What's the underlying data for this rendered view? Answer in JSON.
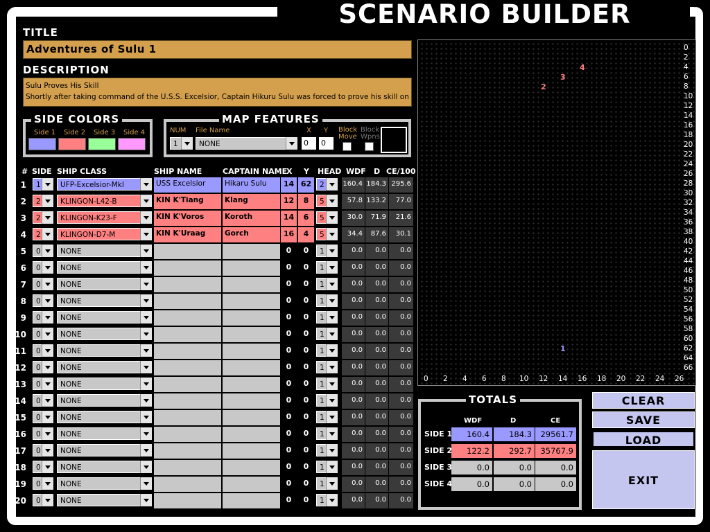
{
  "app_title": "SCENARIO BUILDER",
  "title_label": "TITLE",
  "title_value": "Adventures of Sulu 1",
  "description_label": "DESCRIPTION",
  "description_lines": [
    "Sulu Proves His Skill",
    "Shortly after taking command of the U.S.S. Excelsior, Captain Hikuru Sulu was forced to prove his skill on the"
  ],
  "side_colors": {
    "label": "SIDE COLORS",
    "sides": [
      {
        "label": "Side 1",
        "color": "#9999ff"
      },
      {
        "label": "Side 2",
        "color": "#ff8080"
      },
      {
        "label": "Side 3",
        "color": "#99ff99"
      },
      {
        "label": "Side 4",
        "color": "#ff99ff"
      }
    ]
  },
  "map_features": {
    "label": "MAP FEATURES",
    "num_label": "NUM",
    "num_value": "1",
    "file_name_label": "File Name",
    "file_name_value": "NONE",
    "x_label": "X",
    "x_value": "0",
    "y_label": "Y",
    "y_value": "0",
    "block_move_label": "Block Move",
    "block_wpns_label": "Block Wpns"
  },
  "table_headers": {
    "num": "#",
    "side": "SIDE",
    "ship_class": "SHIP CLASS",
    "ship_name": "SHIP NAME",
    "captain": "CAPTAIN NAME",
    "x": "X",
    "y": "Y",
    "head": "HEAD",
    "wdf": "WDF",
    "d": "D",
    "ce": "CE/100"
  },
  "rows": [
    {
      "n": "1",
      "side": "1",
      "cls": "UFP-Excelsior-MkI",
      "name": "USS Excelsior",
      "capt": "Hikaru Sulu",
      "x": "14",
      "y": "62",
      "head": "2",
      "wdf": "160.4",
      "d": "184.3",
      "ce": "295.6"
    },
    {
      "n": "2",
      "side": "2",
      "cls": "KLINGON-L42-B",
      "name": "KIN K'Tiang",
      "capt": "Klang",
      "x": "12",
      "y": "8",
      "head": "5",
      "wdf": "57.8",
      "d": "133.2",
      "ce": "77.0"
    },
    {
      "n": "3",
      "side": "2",
      "cls": "KLINGON-K23-F",
      "name": "KIN K'Voros",
      "capt": "Koroth",
      "x": "14",
      "y": "6",
      "head": "5",
      "wdf": "30.0",
      "d": "71.9",
      "ce": "21.6"
    },
    {
      "n": "4",
      "side": "2",
      "cls": "KLINGON-D7-M",
      "name": "KIN K'Uraag",
      "capt": "Gorch",
      "x": "16",
      "y": "4",
      "head": "5",
      "wdf": "34.4",
      "d": "87.6",
      "ce": "30.1"
    },
    {
      "n": "5",
      "side": "0",
      "cls": "NONE",
      "name": "",
      "capt": "",
      "x": "0",
      "y": "0",
      "head": "1",
      "wdf": "0.0",
      "d": "0.0",
      "ce": "0.0"
    },
    {
      "n": "6",
      "side": "0",
      "cls": "NONE",
      "name": "",
      "capt": "",
      "x": "0",
      "y": "0",
      "head": "1",
      "wdf": "0.0",
      "d": "0.0",
      "ce": "0.0"
    },
    {
      "n": "7",
      "side": "0",
      "cls": "NONE",
      "name": "",
      "capt": "",
      "x": "0",
      "y": "0",
      "head": "1",
      "wdf": "0.0",
      "d": "0.0",
      "ce": "0.0"
    },
    {
      "n": "8",
      "side": "0",
      "cls": "NONE",
      "name": "",
      "capt": "",
      "x": "0",
      "y": "0",
      "head": "1",
      "wdf": "0.0",
      "d": "0.0",
      "ce": "0.0"
    },
    {
      "n": "9",
      "side": "0",
      "cls": "NONE",
      "name": "",
      "capt": "",
      "x": "0",
      "y": "0",
      "head": "1",
      "wdf": "0.0",
      "d": "0.0",
      "ce": "0.0"
    },
    {
      "n": "10",
      "side": "0",
      "cls": "NONE",
      "name": "",
      "capt": "",
      "x": "0",
      "y": "0",
      "head": "1",
      "wdf": "0.0",
      "d": "0.0",
      "ce": "0.0"
    },
    {
      "n": "11",
      "side": "0",
      "cls": "NONE",
      "name": "",
      "capt": "",
      "x": "0",
      "y": "0",
      "head": "1",
      "wdf": "0.0",
      "d": "0.0",
      "ce": "0.0"
    },
    {
      "n": "12",
      "side": "0",
      "cls": "NONE",
      "name": "",
      "capt": "",
      "x": "0",
      "y": "0",
      "head": "1",
      "wdf": "0.0",
      "d": "0.0",
      "ce": "0.0"
    },
    {
      "n": "13",
      "side": "0",
      "cls": "NONE",
      "name": "",
      "capt": "",
      "x": "0",
      "y": "0",
      "head": "1",
      "wdf": "0.0",
      "d": "0.0",
      "ce": "0.0"
    },
    {
      "n": "14",
      "side": "0",
      "cls": "NONE",
      "name": "",
      "capt": "",
      "x": "0",
      "y": "0",
      "head": "1",
      "wdf": "0.0",
      "d": "0.0",
      "ce": "0.0"
    },
    {
      "n": "15",
      "side": "0",
      "cls": "NONE",
      "name": "",
      "capt": "",
      "x": "0",
      "y": "0",
      "head": "1",
      "wdf": "0.0",
      "d": "0.0",
      "ce": "0.0"
    },
    {
      "n": "16",
      "side": "0",
      "cls": "NONE",
      "name": "",
      "capt": "",
      "x": "0",
      "y": "0",
      "head": "1",
      "wdf": "0.0",
      "d": "0.0",
      "ce": "0.0"
    },
    {
      "n": "17",
      "side": "0",
      "cls": "NONE",
      "name": "",
      "capt": "",
      "x": "0",
      "y": "0",
      "head": "1",
      "wdf": "0.0",
      "d": "0.0",
      "ce": "0.0"
    },
    {
      "n": "18",
      "side": "0",
      "cls": "NONE",
      "name": "",
      "capt": "",
      "x": "0",
      "y": "0",
      "head": "1",
      "wdf": "0.0",
      "d": "0.0",
      "ce": "0.0"
    },
    {
      "n": "19",
      "side": "0",
      "cls": "NONE",
      "name": "",
      "capt": "",
      "x": "0",
      "y": "0",
      "head": "1",
      "wdf": "0.0",
      "d": "0.0",
      "ce": "0.0"
    },
    {
      "n": "20",
      "side": "0",
      "cls": "NONE",
      "name": "",
      "capt": "",
      "x": "0",
      "y": "0",
      "head": "1",
      "wdf": "0.0",
      "d": "0.0",
      "ce": "0.0"
    }
  ],
  "map": {
    "x_labels": [
      "0",
      "2",
      "4",
      "6",
      "8",
      "10",
      "12",
      "14",
      "16",
      "18",
      "20",
      "22",
      "24",
      "26"
    ],
    "y_labels": [
      "0",
      "2",
      "4",
      "6",
      "8",
      "10",
      "12",
      "14",
      "16",
      "18",
      "20",
      "22",
      "24",
      "26",
      "28",
      "30",
      "32",
      "34",
      "36",
      "38",
      "40",
      "42",
      "44",
      "46",
      "48",
      "50",
      "52",
      "54",
      "56",
      "58",
      "60",
      "62",
      "64",
      "66"
    ],
    "markers": [
      {
        "label": "1",
        "x": 14,
        "y": 62,
        "color": "#9999ff"
      },
      {
        "label": "2",
        "x": 12,
        "y": 8,
        "color": "#ff8080"
      },
      {
        "label": "3",
        "x": 14,
        "y": 6,
        "color": "#ff8080"
      },
      {
        "label": "4",
        "x": 16,
        "y": 4,
        "color": "#ff8080"
      }
    ]
  },
  "totals": {
    "label": "TOTALS",
    "col_headers": [
      "WDF",
      "D",
      "CE"
    ],
    "rows": [
      {
        "label": "SIDE 1",
        "wdf": "160.4",
        "d": "184.3",
        "ce": "29561.7",
        "color": "#9999ff"
      },
      {
        "label": "SIDE 2",
        "wdf": "122.2",
        "d": "292.7",
        "ce": "35767.9",
        "color": "#ff8080"
      },
      {
        "label": "SIDE 3",
        "wdf": "0.0",
        "d": "0.0",
        "ce": "0.0",
        "color": "#c8c8c8"
      },
      {
        "label": "SIDE 4",
        "wdf": "0.0",
        "d": "0.0",
        "ce": "0.0",
        "color": "#c8c8c8"
      }
    ]
  },
  "buttons": {
    "clear": "CLEAR",
    "save": "SAVE",
    "load": "LOAD",
    "exit": "EXIT"
  },
  "colors": {
    "none_row": "#c8c8c8",
    "side1": "#9999ff",
    "side2": "#ff8080",
    "gold": "#d4a04e",
    "lcars_button": "#c4c6f0"
  }
}
